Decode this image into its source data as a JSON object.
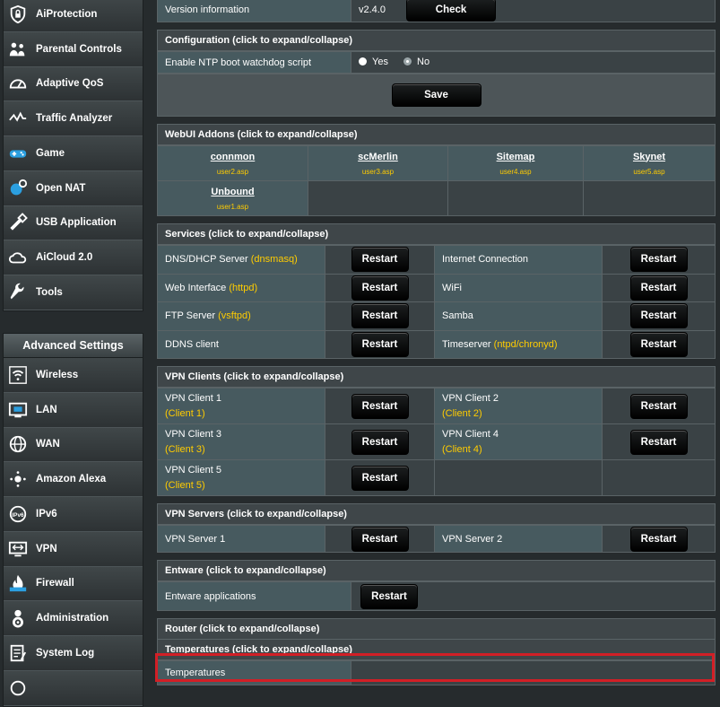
{
  "sidebar": {
    "top_items": [
      {
        "label": "AiProtection",
        "icon": "shield-lock-icon"
      },
      {
        "label": "Parental Controls",
        "icon": "family-icon"
      },
      {
        "label": "Adaptive QoS",
        "icon": "speedometer-icon"
      },
      {
        "label": "Traffic Analyzer",
        "icon": "traffic-icon"
      },
      {
        "label": "Game",
        "icon": "gamepad-icon"
      },
      {
        "label": "Open NAT",
        "icon": "globe-gear-icon"
      },
      {
        "label": "USB Application",
        "icon": "usb-icon"
      },
      {
        "label": "AiCloud 2.0",
        "icon": "cloud-icon"
      },
      {
        "label": "Tools",
        "icon": "wrench-icon"
      }
    ],
    "advanced_header": "Advanced Settings",
    "advanced_items": [
      {
        "label": "Wireless",
        "icon": "wifi-icon"
      },
      {
        "label": "LAN",
        "icon": "lan-icon"
      },
      {
        "label": "WAN",
        "icon": "globe-icon"
      },
      {
        "label": "Amazon Alexa",
        "icon": "alexa-icon"
      },
      {
        "label": "IPv6",
        "icon": "ipv6-icon"
      },
      {
        "label": "VPN",
        "icon": "vpn-icon"
      },
      {
        "label": "Firewall",
        "icon": "firewall-icon"
      },
      {
        "label": "Administration",
        "icon": "admin-gear-icon"
      },
      {
        "label": "System Log",
        "icon": "log-icon"
      }
    ]
  },
  "version": {
    "label": "Version information",
    "value": "v2.4.0",
    "check": "Check"
  },
  "configuration": {
    "title": "Configuration (click to expand/collapse)",
    "ntp_label": "Enable NTP boot watchdog script",
    "yes": "Yes",
    "no": "No",
    "save": "Save"
  },
  "addons": {
    "title": "WebUI Addons (click to expand/collapse)",
    "items": [
      {
        "name": "connmon",
        "page": "user2.asp"
      },
      {
        "name": "scMerlin",
        "page": "user3.asp"
      },
      {
        "name": "Sitemap",
        "page": "user4.asp"
      },
      {
        "name": "Skynet",
        "page": "user5.asp"
      },
      {
        "name": "Unbound",
        "page": "user1.asp"
      }
    ]
  },
  "services": {
    "title": "Services (click to expand/collapse)",
    "restart": "Restart",
    "rows": [
      {
        "left": "DNS/DHCP Server ",
        "left_tag": "(dnsmasq)",
        "right": "Internet Connection",
        "right_tag": ""
      },
      {
        "left": "Web Interface ",
        "left_tag": "(httpd)",
        "right": "WiFi",
        "right_tag": ""
      },
      {
        "left": "FTP Server ",
        "left_tag": "(vsftpd)",
        "right": "Samba",
        "right_tag": ""
      },
      {
        "left": "DDNS client",
        "left_tag": "",
        "right": "Timeserver ",
        "right_tag": "(ntpd/chronyd)"
      }
    ]
  },
  "vpn_clients": {
    "title": "VPN Clients (click to expand/collapse)",
    "items": [
      {
        "name": "VPN Client 1",
        "sub": "(Client 1)"
      },
      {
        "name": "VPN Client 2",
        "sub": "(Client 2)"
      },
      {
        "name": "VPN Client 3",
        "sub": "(Client 3)"
      },
      {
        "name": "VPN Client 4",
        "sub": "(Client 4)"
      },
      {
        "name": "VPN Client 5",
        "sub": "(Client 5)"
      }
    ]
  },
  "vpn_servers": {
    "title": "VPN Servers (click to expand/collapse)",
    "items": [
      "VPN Server 1",
      "VPN Server 2"
    ]
  },
  "entware": {
    "title": "Entware (click to expand/collapse)",
    "label": "Entware applications"
  },
  "router": {
    "title": "Router (click to expand/collapse)"
  },
  "temperatures": {
    "title": "Temperatures (click to expand/collapse)",
    "label": "Temperatures",
    "value": ""
  },
  "colors": {
    "accent": "#ffcc00",
    "highlight": "#d21f26",
    "panel": "#475a5f"
  }
}
